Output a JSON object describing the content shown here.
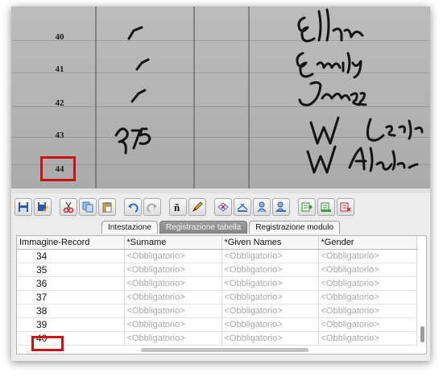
{
  "scan": {
    "row_numbers": [
      "40",
      "41",
      "42",
      "43",
      "44"
    ]
  },
  "toolbar": {
    "buttons": [
      {
        "icon": "save-icon"
      },
      {
        "icon": "save-as-icon"
      },
      {
        "icon": "cut-icon"
      },
      {
        "icon": "copy-icon"
      },
      {
        "icon": "paste-icon"
      },
      {
        "icon": "undo-icon"
      },
      {
        "icon": "redo-icon"
      },
      {
        "icon": "special-character-icon"
      },
      {
        "icon": "pencil-icon"
      },
      {
        "icon": "clear-record-icon"
      },
      {
        "icon": "insert-record-icon"
      },
      {
        "icon": "person-icon"
      },
      {
        "icon": "person-add-icon"
      },
      {
        "icon": "add-row-icon"
      },
      {
        "icon": "insert-row-icon"
      },
      {
        "icon": "delete-row-icon"
      }
    ]
  },
  "tabs": [
    {
      "label": "Intestazione",
      "active": false
    },
    {
      "label": "Registrazione tabella",
      "active": true
    },
    {
      "label": "Registrazione modulo",
      "active": false
    }
  ],
  "table": {
    "columns": [
      "Immagine-Record",
      "*Surname",
      "*Given Names",
      "*Gender"
    ],
    "placeholder": "<Obbligatorio>",
    "rows": [
      "34",
      "35",
      "36",
      "37",
      "38",
      "39",
      "40"
    ]
  },
  "colors": {
    "highlight": "#cc1111",
    "active_tab": "#8e8e8e"
  }
}
